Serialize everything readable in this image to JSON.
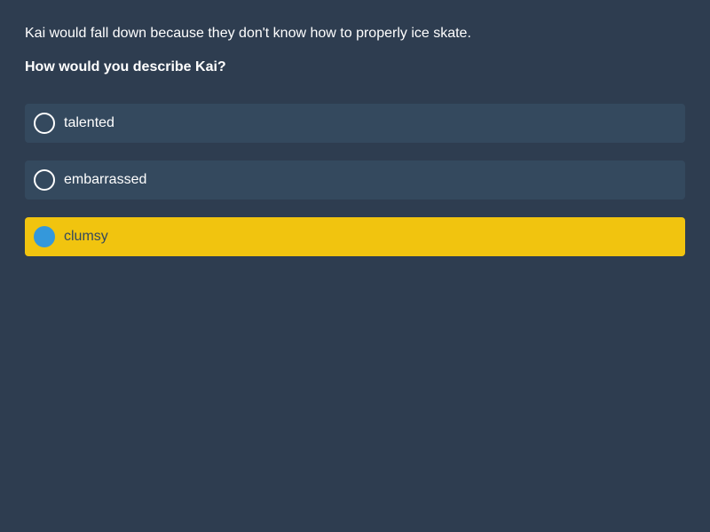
{
  "context": "Kai would fall down because they don't know how to properly ice skate.",
  "question": "How would you describe Kai?",
  "options": [
    {
      "label": "talented",
      "selected": false
    },
    {
      "label": "embarrassed",
      "selected": false
    },
    {
      "label": "clumsy",
      "selected": true
    }
  ],
  "colors": {
    "background": "#2e3d50",
    "option_bg": "#34495e",
    "selected_bg": "#f1c40f",
    "selected_radio": "#3498db"
  }
}
